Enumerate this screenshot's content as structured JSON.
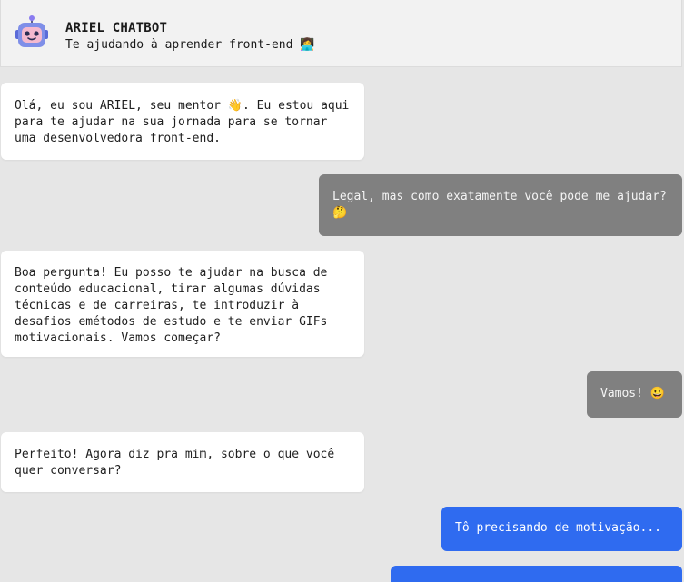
{
  "header": {
    "avatar_icon": "robot-icon",
    "name": "ARIEL CHATBOT",
    "subtitle": "Te ajudando à aprender front-end 👩‍💻"
  },
  "colors": {
    "background": "#e6e6e6",
    "header_bg": "#f2f2f2",
    "bot_bubble": "#ffffff",
    "user_bubble": "#808080",
    "user_bubble_active": "#2f6bf0"
  },
  "messages": [
    {
      "sender": "bot",
      "text": "Olá, eu sou ARIEL, seu mentor 👋. Eu estou aqui para te ajudar na sua jornada para se tornar uma desenvolvedora front-end."
    },
    {
      "sender": "user",
      "text": "Legal, mas como exatamente você pode me ajudar? 🤔"
    },
    {
      "sender": "bot",
      "text": "Boa pergunta! Eu posso te ajudar na busca de conteúdo educacional, tirar algumas dúvidas técnicas e de carreiras, te introduzir à desafios emétodos de estudo e te enviar GIFs motivacionais. Vamos começar?"
    },
    {
      "sender": "user",
      "text": "Vamos! 😃"
    },
    {
      "sender": "bot",
      "text": "Perfeito! Agora diz pra mim, sobre o que você quer conversar?"
    },
    {
      "sender": "user",
      "text": "Tô precisando de motivação..."
    },
    {
      "sender": "user",
      "text": ""
    }
  ]
}
